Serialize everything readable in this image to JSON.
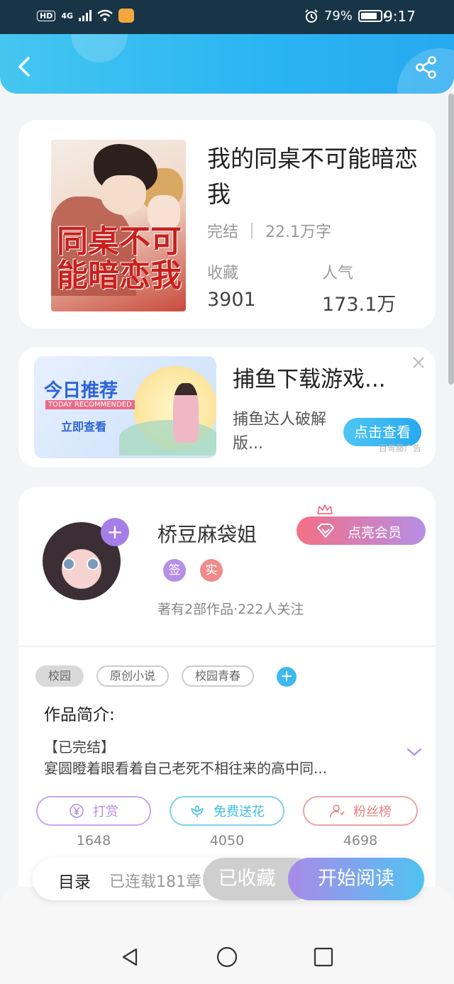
{
  "status_bar": {
    "hd": "HD",
    "network": "4G",
    "battery_percent": "79%",
    "time": "9:17"
  },
  "header": {
    "back_icon": "chevron-left-icon",
    "share_icon": "share-icon",
    "colors": {
      "gradient_start": "#44c6f0",
      "gradient_end": "#27a9ef"
    }
  },
  "book": {
    "title": "我的同桌不可能暗恋我",
    "cover_title": "同桌不可能暗恋我",
    "status": "完结",
    "word_count": "22.1万字",
    "favorites_label": "收藏",
    "favorites_value": "3901",
    "popularity_label": "人气",
    "popularity_value": "173.1万"
  },
  "ad": {
    "image_title": "今日推荐",
    "image_subtitle": "TODAY RECOMMENDED",
    "image_cta": "立即查看",
    "title": "捕鱼下载游戏...",
    "description": "捕鱼达人破解版...",
    "button": "点击查看",
    "source": "百青藤广告"
  },
  "author": {
    "name": "桥豆麻袋姐",
    "badge_sign": "签",
    "badge_real": "实",
    "meta": "著有2部作品·222人关注",
    "vip_button": "点亮会员",
    "follow_plus": "+"
  },
  "tags": [
    "校园",
    "原创小说",
    "校园青春"
  ],
  "tag_add": "+",
  "intro": {
    "heading": "作品简介:",
    "line1": "【已完结】",
    "line2": "宴圆瞪着眼看着自己老死不相往来的高中同..."
  },
  "actions": [
    {
      "label": "打赏",
      "count": "1648",
      "color": "#b58fe6",
      "icon": "yen-coin-icon"
    },
    {
      "label": "免费送花",
      "count": "4050",
      "color": "#3fbfe0",
      "icon": "flower-icon"
    },
    {
      "label": "粉丝榜",
      "count": "4698",
      "color": "#e98080",
      "icon": "fan-user-icon"
    }
  ],
  "bottom_bar": {
    "toc_label": "目录",
    "toc_count": "已连载181章",
    "collected_button": "已收藏",
    "read_button": "开始阅读"
  }
}
